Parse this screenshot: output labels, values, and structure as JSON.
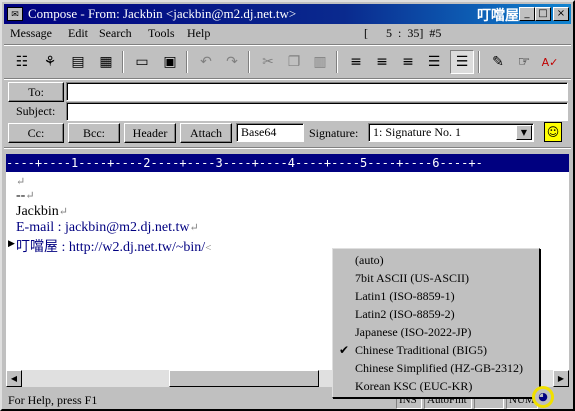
{
  "window": {
    "title": "Compose - From: Jackbin <jackbin@m2.dj.net.tw>",
    "brand": "叮噹屋",
    "minimize": "_",
    "maximize": "□",
    "close": "×"
  },
  "menu": {
    "items": [
      "Message",
      "Edit",
      "Search",
      "Tools",
      "Help"
    ],
    "status": "[      5  :  35]  #5"
  },
  "toolbar": {
    "icons": [
      "address-book-icon",
      "attach-icon",
      "note-icon",
      "spreadsheet-icon",
      "page-icon",
      "save-icon",
      "undo-icon",
      "redo-icon",
      "cut-icon",
      "copy-icon",
      "paste-icon",
      "align-left-icon",
      "align-center-icon",
      "align-right-icon",
      "justify-icon",
      "indent-icon",
      "pen-icon",
      "hand-icon",
      "spellcheck-icon"
    ]
  },
  "header": {
    "to_label": "To:",
    "to_value": "",
    "subject_label": "Subject:",
    "subject_value": "",
    "cc_label": "Cc:",
    "bcc_label": "Bcc:",
    "header_label": "Header",
    "attach_label": "Attach",
    "encoding_value": "Base64",
    "signature_label": "Signature:",
    "signature_value": "1: Signature No. 1"
  },
  "ruler": "----+----1----+----2----+----3----+----4----+----5----+----6----+-",
  "editor": {
    "lines": [
      {
        "text": "",
        "mark": "↵"
      },
      {
        "text": "--",
        "mark": "↵"
      },
      {
        "text": "Jackbin",
        "mark": "↵"
      },
      {
        "text": "E-mail : jackbin@m2.dj.net.tw",
        "mark": "↵"
      },
      {
        "text": "叮噹屋 : http://w2.dj.net.tw/~bin/",
        "mark": "<"
      }
    ]
  },
  "charset_menu": {
    "items": [
      {
        "label": "(auto)",
        "checked": false
      },
      {
        "label": "7bit ASCII (US-ASCII)",
        "checked": false
      },
      {
        "label": "Latin1 (ISO-8859-1)",
        "checked": false
      },
      {
        "label": "Latin2 (ISO-8859-2)",
        "checked": false
      },
      {
        "label": "Japanese (ISO-2022-JP)",
        "checked": false
      },
      {
        "label": "Chinese Traditional (BIG5)",
        "checked": true
      },
      {
        "label": "Chinese Simplified (HZ-GB-2312)",
        "checked": false
      },
      {
        "label": "Korean KSC (EUC-KR)",
        "checked": false
      }
    ]
  },
  "status": {
    "help_text": "For Help, press F1",
    "ins": "INS",
    "autofmt": "AutoFmt",
    "num": "NUM"
  }
}
